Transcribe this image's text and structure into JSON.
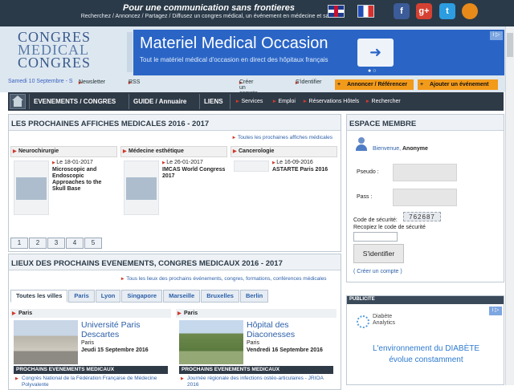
{
  "top_bar": {
    "slogan": "Pour une communication sans frontieres",
    "subslogan": "Recherchez / Annoncez / Partagez / Diffusez un congres médical, un événement en médecine et santé",
    "social": {
      "facebook": "f",
      "google": "g+",
      "twitter": "t",
      "rss": ""
    }
  },
  "logo": {
    "line1": "CONGRES",
    "line2": "MEDICAL",
    "line3": "CONGRES"
  },
  "ad": {
    "title": "Materiel Medical Occasion",
    "subtitle": "Tout le matériel médical d'occasion en direct des hôpitaux français",
    "arrow": "➜",
    "dots": "● ○",
    "info": "i ▷"
  },
  "header_links": {
    "date": "Samedi 10 Septembre - S",
    "newsletter": "Newsletter",
    "rss": "RSS",
    "create_account": "Créer un compte",
    "login": "S'identifier",
    "announce": "Annoncer / Référencer",
    "add_event": "Ajouter un événement"
  },
  "nav": {
    "events": "EVENEMENTS / CONGRES",
    "guide": "GUIDE / Annuaire",
    "liens": "LIENS",
    "services": "Services",
    "emploi": "Emploi",
    "hotels": "Réservations Hôtels",
    "search": "Rechercher"
  },
  "affiches": {
    "title": "LES PROCHAINES AFFICHES MEDICALES 2016 - 2017",
    "link": "Toutes les prochaines affiches médicales",
    "columns": [
      {
        "category": "Neurochirurgie",
        "date": "Le 18-01-2017",
        "event": "Microscopic and Endoscopic Approaches to the Skull Base"
      },
      {
        "category": "Médecine esthétique",
        "date": "Le 26-01-2017",
        "event": "IMCAS World Congress 2017"
      },
      {
        "category": "Cancerologie",
        "date": "Le 16-09-2016",
        "event": "ASTARTE Paris 2016"
      }
    ],
    "pages": [
      "1",
      "2",
      "3",
      "4",
      "5"
    ]
  },
  "lieux": {
    "title": "LIEUX DES PROCHAINS EVENEMENTS, CONGRES MEDICAUX 2016 - 2017",
    "link": "Tous les lieux des prochains événements, congres, formations, conférences médicales",
    "tabs": [
      "Toutes les villes",
      "Paris",
      "Lyon",
      "Singapore",
      "Marseille",
      "Bruxelles",
      "Berlin"
    ],
    "venues": [
      {
        "header": "Paris",
        "name": "Université Paris Descartes",
        "city": "Paris",
        "date": "Jeudi 15 Septembre 2016",
        "strip": "PROCHAINS EVENEMENTS MEDICAUX",
        "event": "Congrès National de la Fédération Française de Médecine Polyvalente"
      },
      {
        "header": "Paris",
        "name": "Hôpital des Diaconesses",
        "city": "Paris",
        "date": "Vendredi 16 Septembre 2016",
        "strip": "PROCHAINS EVENEMENTS MEDICAUX",
        "event": "Journée régionale des infections ostéo-articulaires - JRIOA 2016"
      }
    ]
  },
  "membre": {
    "title": "ESPACE MEMBRE",
    "welcome": "Bienvenue,",
    "user": "Anonyme",
    "pseudo_label": "Pseudo :",
    "pass_label": "Pass :",
    "code_label": "Code de sécurité:",
    "captcha": "762687",
    "recopy_label": "Recopiez le code de sécurité",
    "login_button": "S'identifier",
    "create_link": "( Créer un compte )"
  },
  "pub": {
    "label": "PUBLICITE",
    "brand_1": "Diabète",
    "brand_2": "Analytics",
    "line1": "L'environnement du DIABÈTE",
    "line2": "évolue constamment",
    "info": "i ▷"
  }
}
